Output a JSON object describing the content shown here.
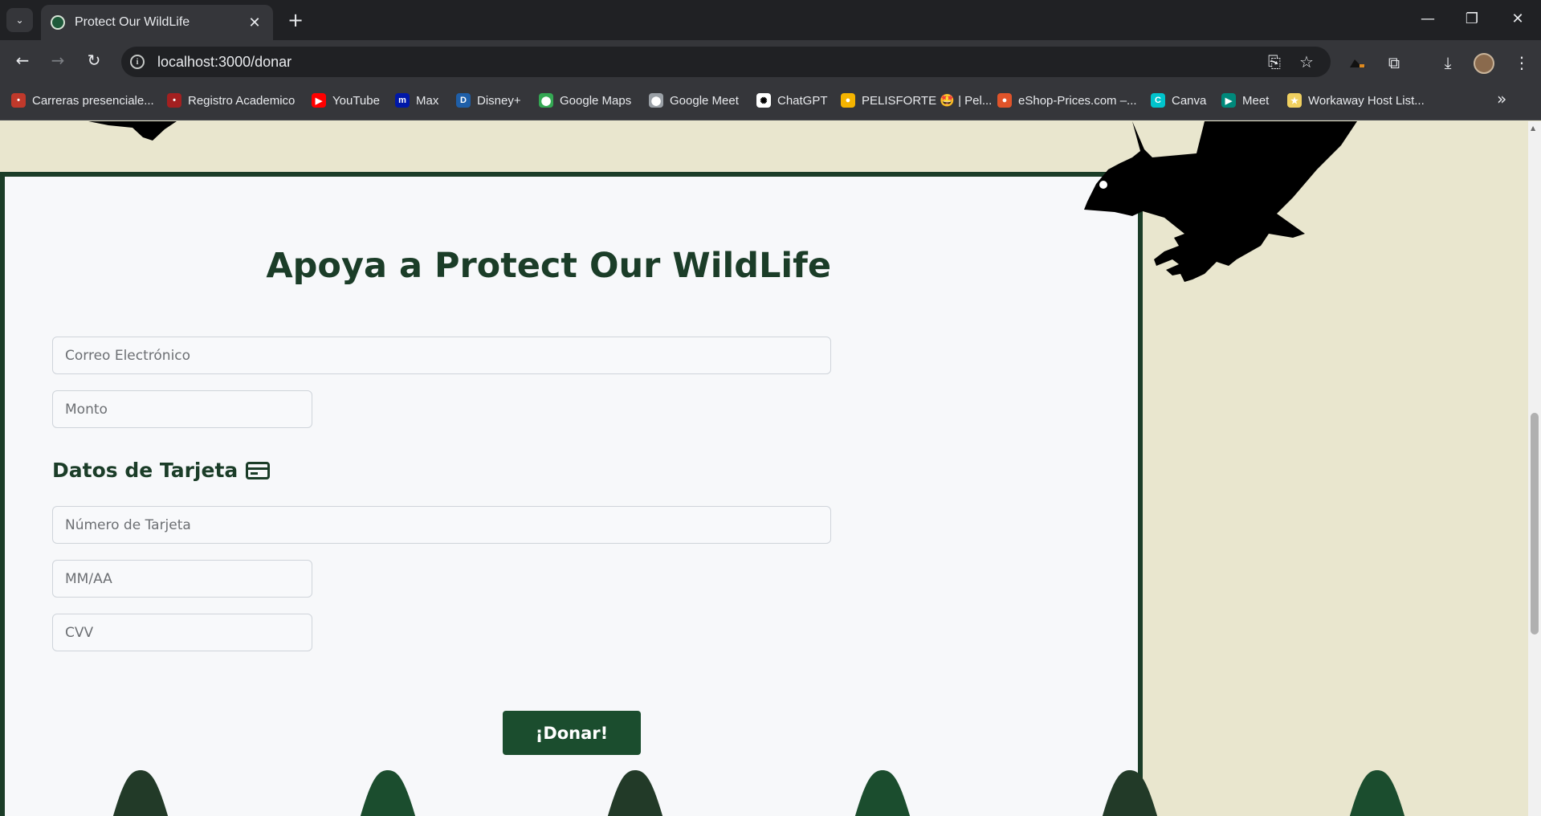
{
  "browser": {
    "tab_title": "Protect Our WildLife",
    "url": "localhost:3000/donar",
    "bookmarks": [
      {
        "label": "Carreras presenciale...",
        "color": "#c0392b",
        "glyph": "•"
      },
      {
        "label": "Registro Academico",
        "color": "#a32020",
        "glyph": "•"
      },
      {
        "label": "YouTube",
        "color": "#ff0000",
        "glyph": "▶"
      },
      {
        "label": "Max",
        "color": "#0018a8",
        "glyph": "m"
      },
      {
        "label": "Disney+",
        "color": "#1f5fa8",
        "glyph": "D"
      },
      {
        "label": "Google Maps",
        "color": "#34a853",
        "glyph": "⬤"
      },
      {
        "label": "Google Meet",
        "color": "#9aa0a6",
        "glyph": "⬤"
      },
      {
        "label": "ChatGPT",
        "color": "#ffffff",
        "glyph": "✺"
      },
      {
        "label": "PELISFORTE 🤩 | Pel...",
        "color": "#f5b400",
        "glyph": "●"
      },
      {
        "label": "eShop-Prices.com –...",
        "color": "#e0542a",
        "glyph": "●"
      },
      {
        "label": "Canva",
        "color": "#00c4cc",
        "glyph": "C"
      },
      {
        "label": "Meet",
        "color": "#00897b",
        "glyph": "▶"
      },
      {
        "label": "Workaway Host List...",
        "color": "#f0d060",
        "glyph": "★"
      }
    ]
  },
  "page": {
    "title": "Apoya a Protect Our WildLife",
    "email_placeholder": "Correo Electrónico",
    "amount_placeholder": "Monto",
    "card_section_title": "Datos de Tarjeta",
    "card_number_placeholder": "Número de Tarjeta",
    "expiry_placeholder": "MM/AA",
    "cvv_placeholder": "CVV",
    "donate_label": "¡Donar!"
  },
  "colors": {
    "primary_green": "#1b3d28",
    "button_green": "#1b4d2e",
    "page_beige": "#e9e6ce",
    "card_bg": "#f7f8fa"
  },
  "icons": [
    "credit-card-icon",
    "eagle-silhouette",
    "pine-tree"
  ]
}
